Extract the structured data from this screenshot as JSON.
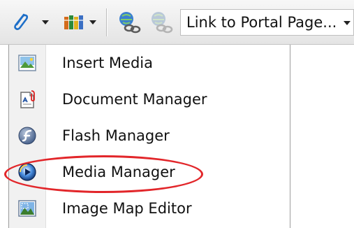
{
  "toolbar": {
    "hyperlink_icon": "hyperlink-icon",
    "library_icon": "library-books-icon",
    "link_icon": "link-icon",
    "unlink_icon": "unlink-icon",
    "portal_dropdown": {
      "label": "Link to Portal Page..."
    }
  },
  "menu": {
    "items": [
      {
        "label": "Insert Media",
        "icon": "insert-media-icon"
      },
      {
        "label": "Document Manager",
        "icon": "document-manager-icon"
      },
      {
        "label": "Flash Manager",
        "icon": "flash-manager-icon"
      },
      {
        "label": "Media Manager",
        "icon": "media-manager-icon",
        "highlighted": true
      },
      {
        "label": "Image Map Editor",
        "icon": "image-map-editor-icon"
      }
    ]
  },
  "colors": {
    "highlight": "#e2262a",
    "toolbar_bg": "#ececec",
    "menu_gutter": "#f1f1f1"
  }
}
